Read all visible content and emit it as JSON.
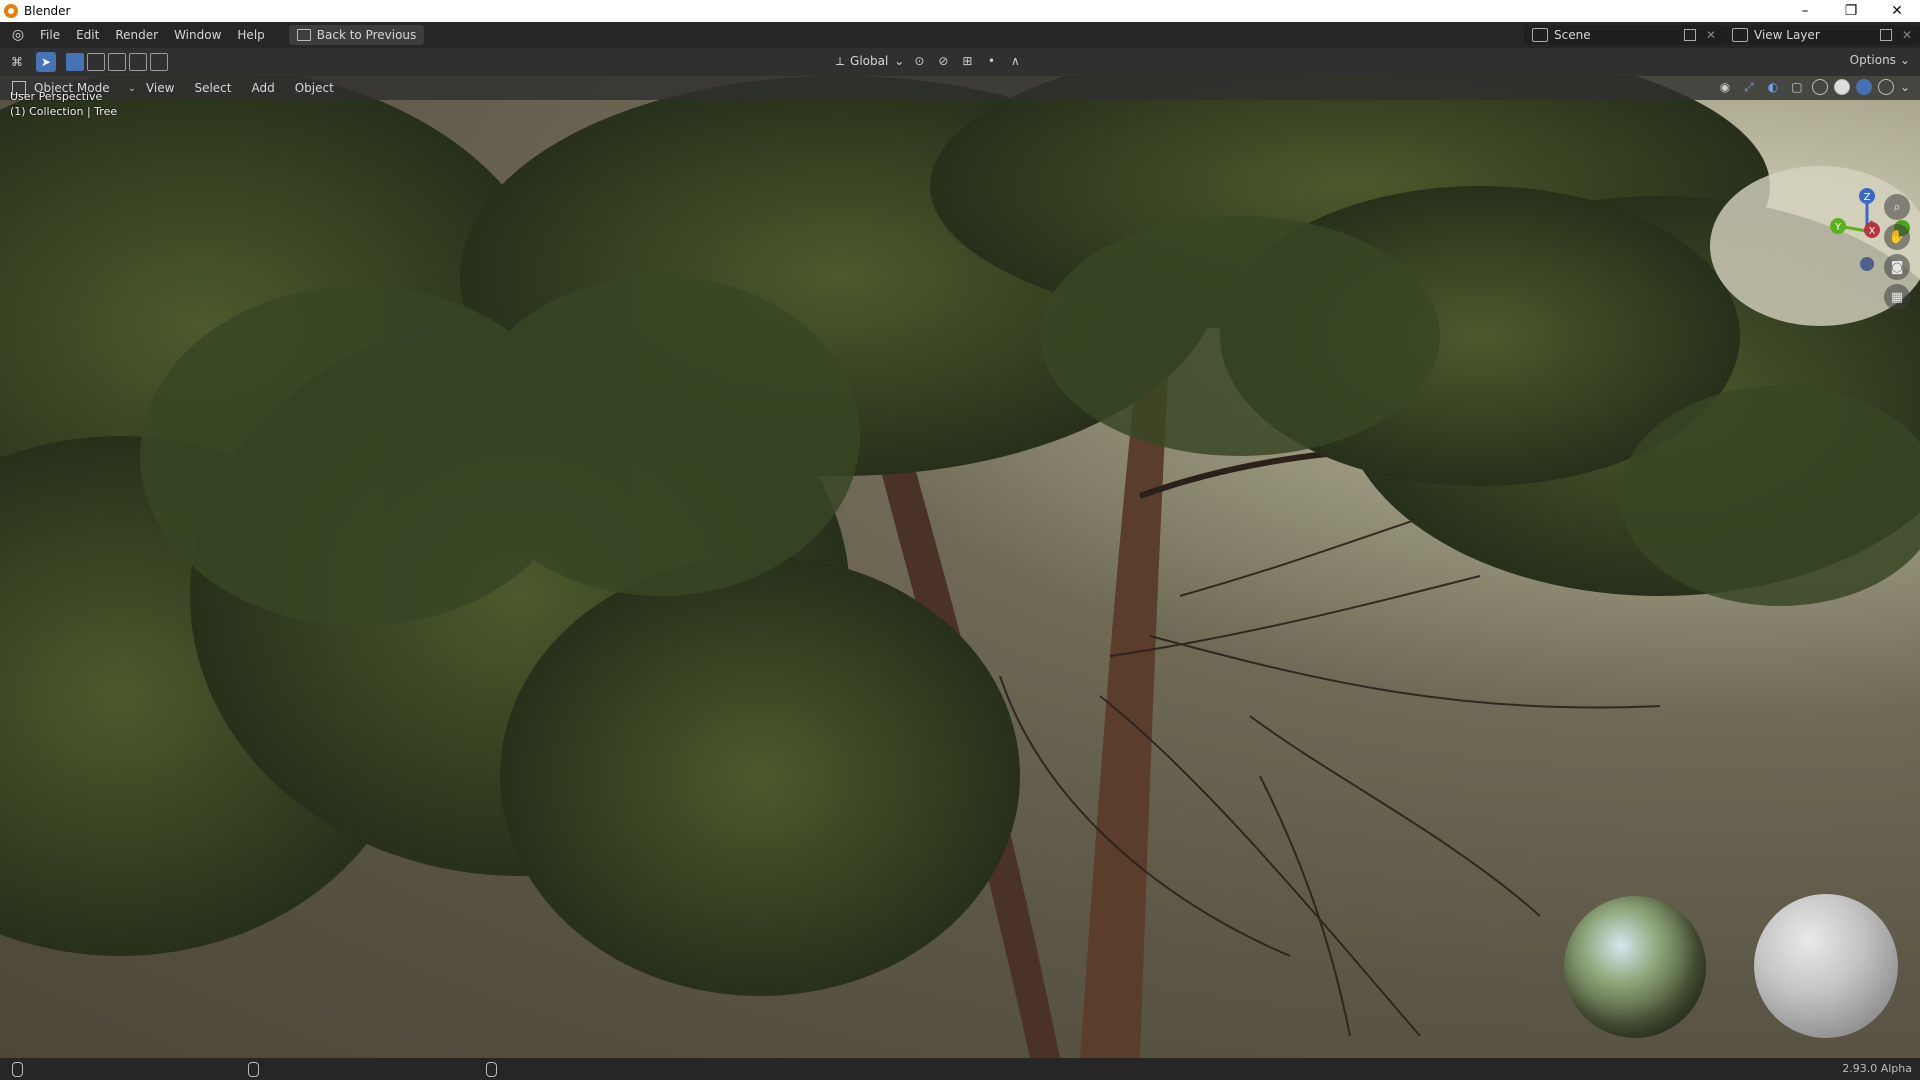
{
  "window": {
    "title": "Blender",
    "controls": {
      "minimize": "–",
      "maximize": "❐",
      "close": "✕"
    }
  },
  "menubar": {
    "items": [
      "File",
      "Edit",
      "Render",
      "Window",
      "Help"
    ],
    "back_button": "Back to Previous",
    "scene": "Scene",
    "view_layer": "View Layer"
  },
  "toolheader": {
    "transform_orientation": "Global",
    "options": "Options"
  },
  "viewport_header": {
    "mode": "Object Mode",
    "menus": [
      "View",
      "Select",
      "Add",
      "Object"
    ]
  },
  "viewport": {
    "perspective": "User Perspective",
    "collection_info": "(1) Collection | Tree",
    "gizmo": {
      "z": "Z",
      "y": "Y",
      "x": "X"
    },
    "nav_icons": [
      "zoom-icon",
      "pan-hand-icon",
      "camera-icon",
      "grid-icon"
    ]
  },
  "statusbar": {
    "version": "2.93.0 Alpha"
  },
  "colors": {
    "accent": "#4772b3",
    "bg_dark": "#1d1d1d",
    "header": "#303030"
  }
}
